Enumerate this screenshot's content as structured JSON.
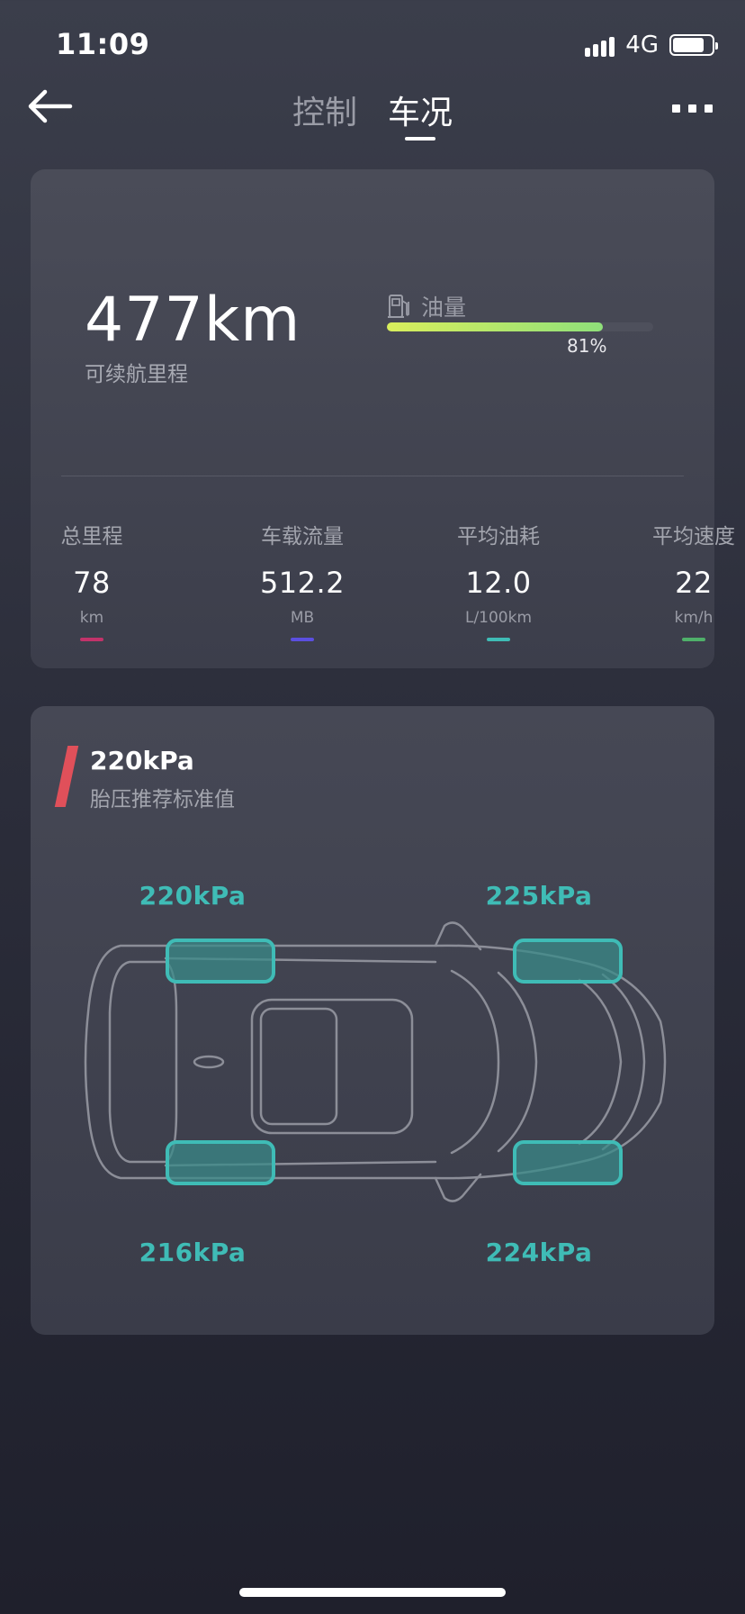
{
  "status_bar": {
    "time": "11:09",
    "network": "4G",
    "battery_level": 0.8,
    "icons": [
      "signal-icon",
      "battery-icon"
    ]
  },
  "nav": {
    "back_icon": "arrow-left-icon",
    "tabs": [
      {
        "label": "控制",
        "active": false
      },
      {
        "label": "车况",
        "active": true
      }
    ],
    "more_icon": "more-horizontal-icon"
  },
  "range_card": {
    "range_value": "477km",
    "range_label": "可续航里程",
    "fuel": {
      "icon": "fuel-pump-icon",
      "label": "油量",
      "percent_text": "81%",
      "percent": 81
    },
    "stats": [
      {
        "label": "总里程",
        "value": "78",
        "unit": "km",
        "color": "#c2336a"
      },
      {
        "label": "车载流量",
        "value": "512.2",
        "unit": "MB",
        "color": "#5b4fe0"
      },
      {
        "label": "平均油耗",
        "value": "12.0",
        "unit": "L/100km",
        "color": "#3fbcb6"
      },
      {
        "label": "平均速度",
        "value": "22",
        "unit": "km/h",
        "color": "#4fb06a"
      }
    ]
  },
  "tire_card": {
    "standard_value": "220kPa",
    "standard_label": "胎压推荐标准值",
    "tires": {
      "front_left": "220kPa",
      "front_right": "225kPa",
      "rear_left": "216kPa",
      "rear_right": "224kPa"
    },
    "tire_color": "#3fbcb6"
  }
}
